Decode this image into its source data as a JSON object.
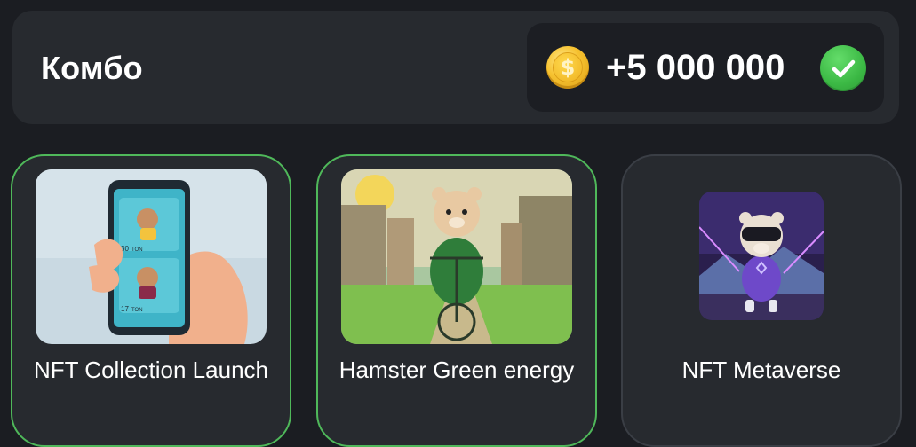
{
  "combo": {
    "title": "Комбо",
    "reward": "+5 000 000",
    "coin_icon": "dollar-coin-icon",
    "status_icon": "check-circle-icon",
    "colors": {
      "coin": "#f6c230",
      "check": "#3bb844",
      "selected_border": "#4fb85a"
    }
  },
  "cards": [
    {
      "label": "NFT Collection Launch",
      "image": "phone-nft-listing-image",
      "selected": true,
      "phone_items": [
        {
          "price": "30",
          "unit": "TON"
        },
        {
          "price": "17",
          "unit": "TON"
        }
      ]
    },
    {
      "label": "Hamster Green energy",
      "image": "hamster-on-bicycle-image",
      "selected": true
    },
    {
      "label": "NFT Metaverse",
      "image": "hamster-vr-metaverse-image",
      "selected": false
    }
  ]
}
